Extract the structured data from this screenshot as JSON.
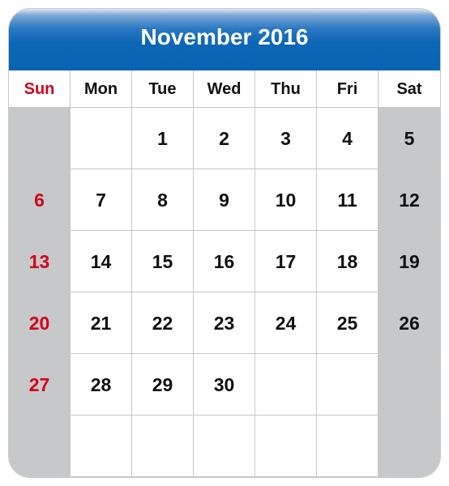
{
  "calendar": {
    "title": "November 2016",
    "weekdays": [
      "Sun",
      "Mon",
      "Tue",
      "Wed",
      "Thu",
      "Fri",
      "Sat"
    ],
    "weeks": [
      [
        "",
        "",
        "1",
        "2",
        "3",
        "4",
        "5"
      ],
      [
        "6",
        "7",
        "8",
        "9",
        "10",
        "11",
        "12"
      ],
      [
        "13",
        "14",
        "15",
        "16",
        "17",
        "18",
        "19"
      ],
      [
        "20",
        "21",
        "22",
        "23",
        "24",
        "25",
        "26"
      ],
      [
        "27",
        "28",
        "29",
        "30",
        "",
        "",
        ""
      ],
      [
        "",
        "",
        "",
        "",
        "",
        "",
        ""
      ]
    ],
    "colors": {
      "header_blue": "#0a63b3",
      "sunday_red": "#d3001b",
      "weekend_gray": "#c7c8ca"
    }
  }
}
